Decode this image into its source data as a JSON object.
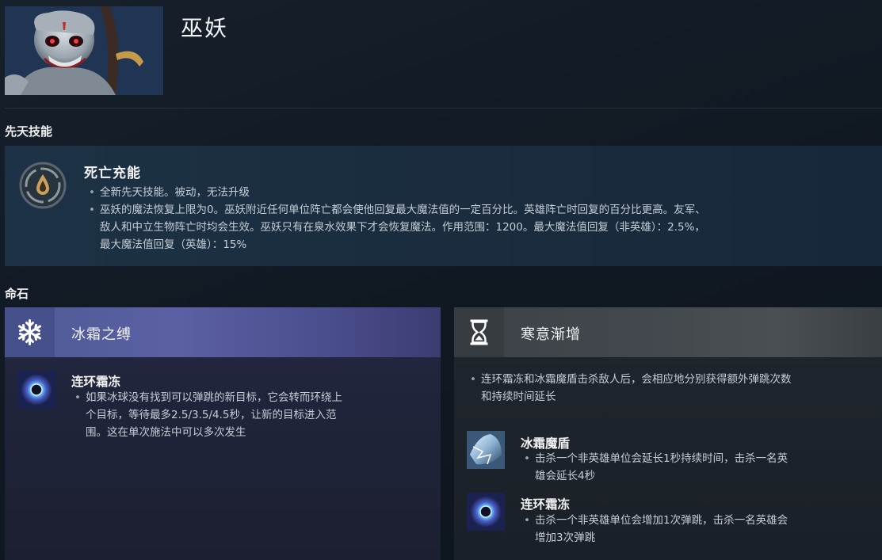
{
  "hero": {
    "name": "巫妖"
  },
  "innate": {
    "section_title": "先天技能",
    "ability_name": "死亡充能",
    "bullets": [
      "全新先天技能。被动，无法升级",
      "巫妖的魔法恢复上限为0。巫妖附近任何单位阵亡都会使他回复最大魔法值的一定百分比。英雄阵亡时回复的百分比更高。友军、",
      "敌人和中立生物阵亡时均会生效。巫妖只有在泉水效果下才会恢复魔法。作用范围：1200。最大魔法值回复（非英雄）：2.5%，",
      "最大魔法值回复（英雄）：15%"
    ]
  },
  "facets": {
    "section_title": "命石",
    "left": {
      "title": "冰霜之缚",
      "ability_name": "连环霜冻",
      "lines": [
        "如果冰球没有找到可以弹跳的新目标，它会转而环绕上",
        "个目标，等待最多2.5/3.5/4.5秒，让新的目标进入范",
        "围。这在单次施法中可以多次发生"
      ]
    },
    "right": {
      "title": "寒意渐增",
      "intro_lines": [
        "连环霜冻和冰霜魔盾击杀敌人后，会相应地分别获得额外弹跳次数",
        "和持续时间延长"
      ],
      "abilities": [
        {
          "name": "冰霜魔盾",
          "lines": [
            "击杀一个非英雄单位会延长1秒持续时间，击杀一名英",
            "雄会延长4秒"
          ]
        },
        {
          "name": "连环霜冻",
          "lines": [
            "击杀一个非英雄单位会增加1次弹跳，击杀一名英雄会",
            "增加3次弹跳"
          ]
        }
      ]
    }
  }
}
